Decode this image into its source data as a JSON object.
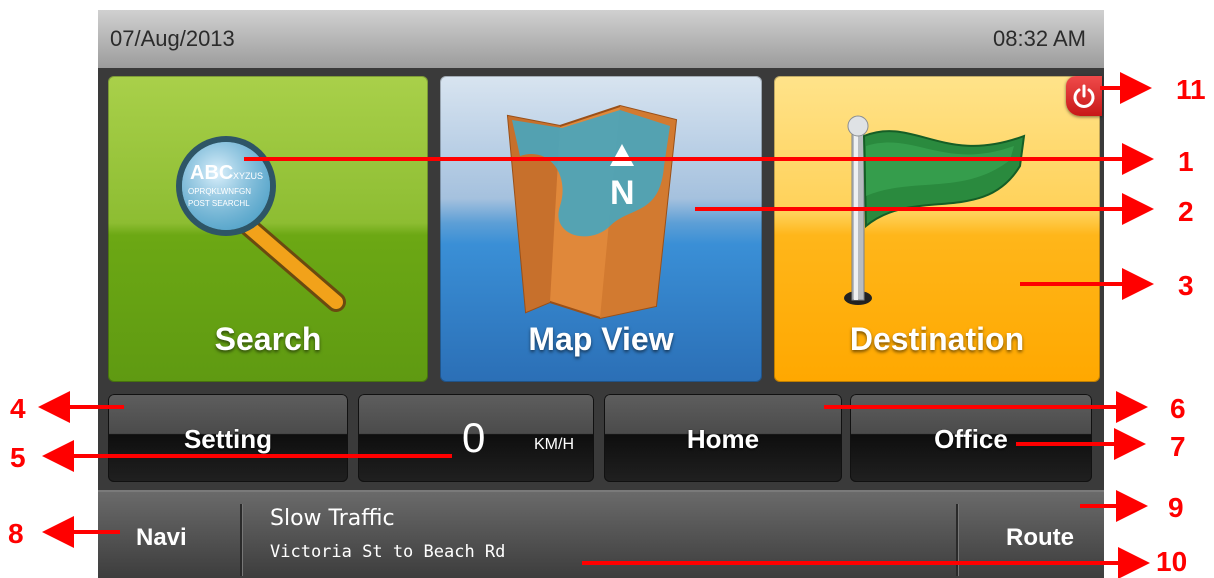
{
  "status_bar": {
    "date": "07/Aug/2013",
    "time": "08:32 AM"
  },
  "tiles": {
    "search": {
      "label": "Search",
      "icon": "magnifier-icon",
      "lens_text": [
        "ABC",
        "XYZUS",
        "OPRQKLWNFGN",
        "POST SEARCHL"
      ]
    },
    "map_view": {
      "label": "Map View",
      "icon": "map-icon",
      "compass": "N"
    },
    "destination": {
      "label": "Destination",
      "icon": "flag-icon"
    }
  },
  "power_button": {
    "icon": "power-icon"
  },
  "buttons": {
    "setting": "Setting",
    "speed_value": "0",
    "speed_unit": "KM/H",
    "home": "Home",
    "office": "Office"
  },
  "bottom_bar": {
    "navi": "Navi",
    "traffic_title": "Slow Traffic",
    "traffic_detail": "Victoria St to Beach Rd",
    "route": "Route"
  },
  "callouts": [
    "1",
    "2",
    "3",
    "4",
    "5",
    "6",
    "7",
    "8",
    "9",
    "10",
    "11"
  ],
  "colors": {
    "callout": "#ff0000",
    "search_tile": "#8dbd32",
    "map_tile": "#3a8fd6",
    "destination_tile": "#ffb61a",
    "power": "#e02424"
  }
}
